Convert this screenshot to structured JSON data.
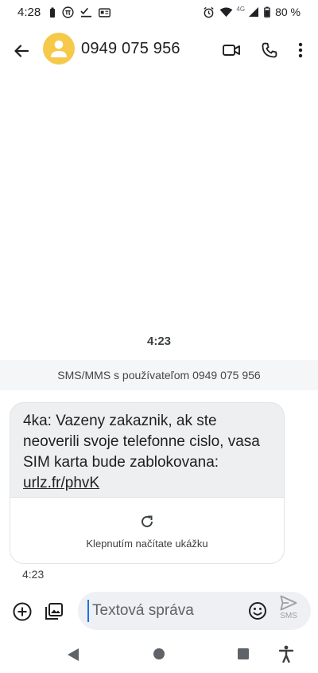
{
  "status_bar": {
    "time": "4:28",
    "network": "4G",
    "battery": "80 %",
    "icons": [
      "battery-saver-icon",
      "pi-icon",
      "checklist-icon",
      "card-icon",
      "alarm-icon",
      "wifi-icon",
      "signal-icon",
      "battery-icon"
    ]
  },
  "top_bar": {
    "title": "0949 075 956",
    "icons": [
      "back-arrow-icon",
      "person-icon",
      "video-call-icon",
      "phone-icon",
      "more-vert-icon"
    ]
  },
  "conversation": {
    "day_time": "4:23",
    "info": "SMS/MMS s používateľom 0949 075 956",
    "messages": [
      {
        "text_before_link": "4ka: Vazeny zakaznik, ak ste neoverili svoje telefonne cislo, vasa SIM karta bude zablokovana: ",
        "link": "urlz.fr/phvK",
        "preview_label": "Klepnutím načítate ukážku",
        "time": "4:23"
      }
    ]
  },
  "compose": {
    "placeholder": "Textová správa",
    "send_label": "SMS",
    "icons": [
      "add-circle-icon",
      "gallery-icon",
      "emoji-icon",
      "send-icon"
    ]
  },
  "nav_bar": {
    "icons": [
      "nav-back-icon",
      "nav-home-icon",
      "nav-recents-icon",
      "accessibility-icon"
    ]
  },
  "colors": {
    "avatar": "#f6c94a",
    "bubble": "#eeeff1",
    "compose": "#eef0f3",
    "cursor": "#1a73e8"
  }
}
